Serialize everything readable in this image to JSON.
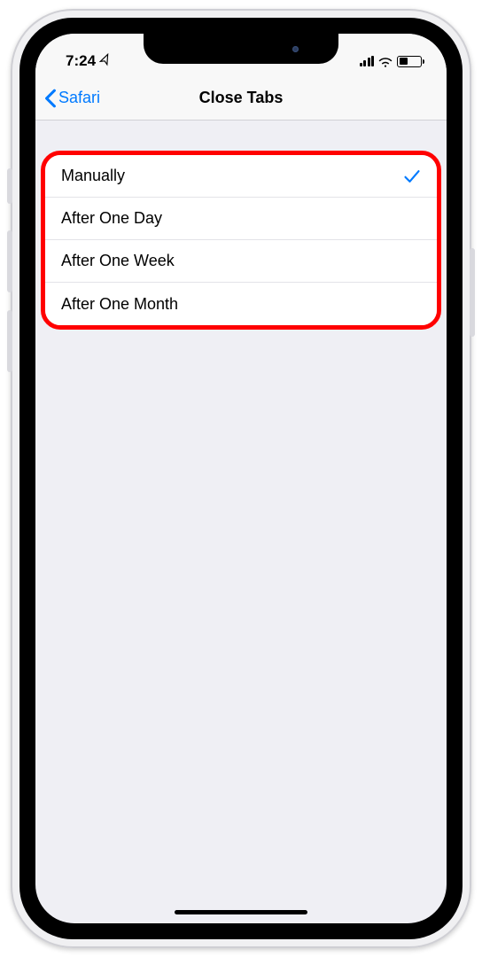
{
  "statusBar": {
    "time": "7:24",
    "locationGlyph": "➤"
  },
  "nav": {
    "backLabel": "Safari",
    "title": "Close Tabs"
  },
  "options": [
    {
      "label": "Manually",
      "selected": true
    },
    {
      "label": "After One Day",
      "selected": false
    },
    {
      "label": "After One Week",
      "selected": false
    },
    {
      "label": "After One Month",
      "selected": false
    }
  ]
}
